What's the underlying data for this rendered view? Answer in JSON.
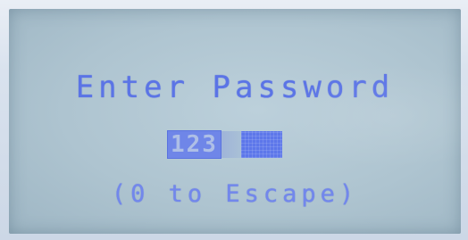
{
  "lcd": {
    "line1": "Enter Password",
    "password_entered": "123",
    "line3": "(0 to Escape)"
  },
  "colors": {
    "text": "#5b74e6",
    "screen_background": "#b2c7d3",
    "cursor_block": "#5d77ea"
  }
}
